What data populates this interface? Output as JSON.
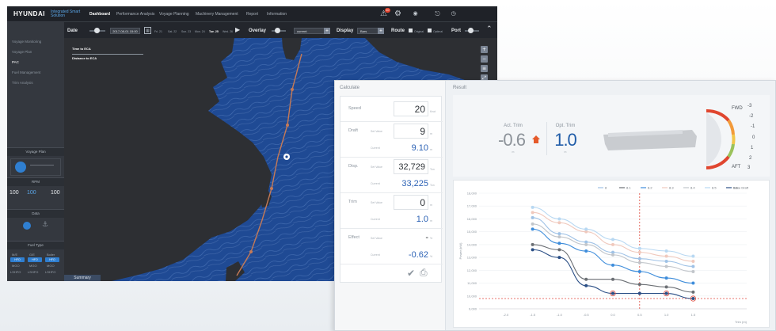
{
  "app": {
    "brand": "HYUNDAI",
    "brand_sub": "Integrated Smart Solution",
    "nav": [
      "Dashboard",
      "Performance Analysis",
      "Voyage Planning",
      "Machinery Management",
      "Report",
      "Information"
    ],
    "nav_active": 0,
    "notification_count": "10"
  },
  "controls": {
    "date_label": "Date",
    "date_value": "2017-08-01 15:00",
    "day_labels": [
      "Fri. 21",
      "Sat. 22",
      "Sun. 23",
      "Mon. 24",
      "Tue. 25",
      "Wed. 26"
    ],
    "overlay_label": "Overlay",
    "overlay_value": "current",
    "display_label": "Display",
    "display_value": "Bars",
    "route_label": "Route",
    "route_opt1": "Original",
    "route_opt2": "Optimal",
    "port_label": "Port"
  },
  "sidebar": {
    "items": [
      "Voyage Monitoring",
      "Voyage Plan",
      "PAC",
      "Fuel Management",
      "Trim Analysis"
    ],
    "selected": 2,
    "voyage_plan_title": "Voyage Plan",
    "rpm_label": "RPM",
    "rpm_value": "100",
    "speed_value": "100",
    "ratio_value": "100",
    "sections": [
      "Voyage Plan",
      "RPM",
      "Data",
      "Fuel Type"
    ],
    "fuel_cols": [
      "M/E",
      "G/E",
      "Boiler"
    ],
    "fuel_rows": [
      "HFO",
      "MGO",
      "LSHFO"
    ]
  },
  "map_info": {
    "time_to_eca": "Time to ECA",
    "distance_to_eca": "Distance to ECA",
    "summary_tab": "Summary"
  },
  "calc": {
    "title": "Calculate",
    "rows": [
      {
        "label": "Speed",
        "sub": "",
        "box": "20",
        "unit": "Knot"
      },
      {
        "label": "Draft",
        "sub": "Set Value",
        "box": "9",
        "unit": "m",
        "calc": "9.10",
        "calc_sub": "Current",
        "calc_unit": "m"
      },
      {
        "label": "Disp.",
        "sub": "Set Value",
        "box": "32,729",
        "unit": "Ton",
        "calc": "33,225",
        "calc_sub": "Current",
        "calc_unit": "Ton"
      },
      {
        "label": "Trim",
        "sub": "Set Value",
        "box": "0",
        "unit": "m",
        "calc": "1.0",
        "calc_sub": "Current",
        "calc_unit": "m"
      },
      {
        "label": "Effect",
        "sub": "Set Value",
        "box": "-",
        "unit": "%",
        "calc": "-0.62",
        "calc_sub": "Current",
        "calc_unit": "%"
      }
    ]
  },
  "result": {
    "title": "Result",
    "act_trim_label": "Act. Trim",
    "act_trim_value": "-0.6",
    "act_trim_unit": "m",
    "opt_trim_label": "Opt. Trim",
    "opt_trim_value": "1.0",
    "opt_trim_unit": "m",
    "gauge_top": "FWD",
    "gauge_bottom": "AFT",
    "gauge_ticks": [
      "-3",
      "-2",
      "-1",
      "0",
      "1",
      "2",
      "3"
    ],
    "colors": {
      "act": "#8c9299",
      "opt": "#1f5ca8",
      "warn": "#e55a2b"
    }
  },
  "chart_data": {
    "type": "line",
    "ylabel": "Power (kW)",
    "xlabel": "Trim (m)",
    "legend_extra": "Base Draft",
    "x": [
      -2.0,
      -1.5,
      -1.0,
      -0.5,
      0.0,
      0.5,
      1.0,
      1.5
    ],
    "yticks": [
      "18,000",
      "17,000",
      "16,000",
      "15,000",
      "14,000",
      "13,000",
      "12,000",
      "11,000",
      "10,000",
      "9,000"
    ],
    "xticks": [
      "-2.0",
      "-1.5",
      "-1.0",
      "-0.5",
      "0.0",
      "0.5",
      "1.0",
      "1.5"
    ],
    "ylim": [
      9000,
      18000
    ],
    "xlim": [
      -2.5,
      2.5
    ],
    "series": [
      {
        "name": "8",
        "color": "#9fc2e6",
        "values": [
          null,
          16100,
          14850,
          14200,
          13400,
          12900,
          12700,
          12300
        ]
      },
      {
        "name": "8.1",
        "color": "#6b6f74",
        "values": [
          null,
          14000,
          13600,
          11300,
          11300,
          10900,
          10700,
          10300
        ]
      },
      {
        "name": "8.2",
        "color": "#3e8ddb",
        "values": [
          null,
          15200,
          14100,
          13500,
          12400,
          11900,
          11400,
          11000
        ]
      },
      {
        "name": "8.3",
        "color": "#f0c9bd",
        "values": [
          null,
          16500,
          15700,
          15000,
          14000,
          13400,
          13100,
          12700
        ]
      },
      {
        "name": "8.4",
        "color": "#c2c6cb",
        "values": [
          null,
          15600,
          14600,
          14000,
          13200,
          12600,
          12300,
          11900
        ]
      },
      {
        "name": "8.5",
        "color": "#b8d8f2",
        "values": [
          null,
          16900,
          16000,
          15200,
          14400,
          13700,
          13500,
          13100
        ]
      },
      {
        "name": "8.6",
        "color": "#2b4f86",
        "values": [
          null,
          13600,
          13000,
          10800,
          10200,
          10200,
          10200,
          9800
        ]
      }
    ],
    "ref_h": 9800,
    "ref_v": 0.5,
    "ref_color": "#e04a3c"
  }
}
